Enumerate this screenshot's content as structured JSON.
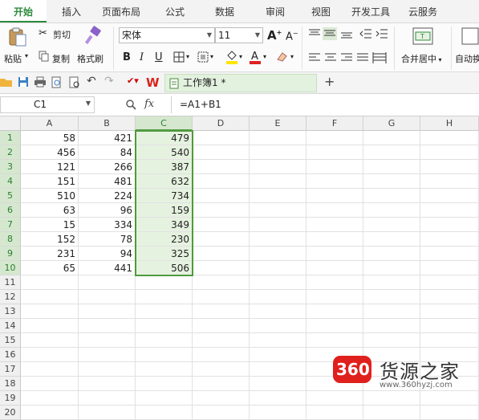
{
  "ribbon_tabs": [
    "开始",
    "插入",
    "页面布局",
    "公式",
    "数据",
    "审阅",
    "视图",
    "开发工具",
    "云服务"
  ],
  "active_tab": "开始",
  "clipboard": {
    "paste": "粘贴",
    "cut": "剪切",
    "copy": "复制",
    "format_painter": "格式刷"
  },
  "font": {
    "name": "宋体",
    "size": "11",
    "bold": "B",
    "italic": "I",
    "underline": "U",
    "grow": "A",
    "shrink": "A"
  },
  "merge_label": "合并居中",
  "wrap_label": "自动换",
  "quick_access": {
    "doc_name": "工作簿1 *",
    "new_tab": "+"
  },
  "formula_bar": {
    "name_box": "C1",
    "fx": "fx",
    "formula": "=A1+B1"
  },
  "columns": [
    "A",
    "B",
    "C",
    "D",
    "E",
    "F",
    "G",
    "H"
  ],
  "selected_column": "C",
  "row_numbers": [
    "1",
    "2",
    "3",
    "4",
    "5",
    "6",
    "7",
    "8",
    "9",
    "10",
    "11",
    "12",
    "13",
    "14",
    "15",
    "16",
    "17",
    "18",
    "19",
    "20"
  ],
  "rows": [
    [
      "58",
      "421",
      "479"
    ],
    [
      "456",
      "84",
      "540"
    ],
    [
      "121",
      "266",
      "387"
    ],
    [
      "151",
      "481",
      "632"
    ],
    [
      "510",
      "224",
      "734"
    ],
    [
      "63",
      "96",
      "159"
    ],
    [
      "15",
      "334",
      "349"
    ],
    [
      "152",
      "78",
      "230"
    ],
    [
      "231",
      "94",
      "325"
    ],
    [
      "65",
      "441",
      "506"
    ]
  ],
  "watermark": {
    "badge": "360",
    "title": "货源之家",
    "url": "www.360hyzj.com"
  },
  "colors": {
    "accent": "#2e8b3d",
    "selection": "#4f9a3d",
    "watermark_red": "#e0201c"
  }
}
